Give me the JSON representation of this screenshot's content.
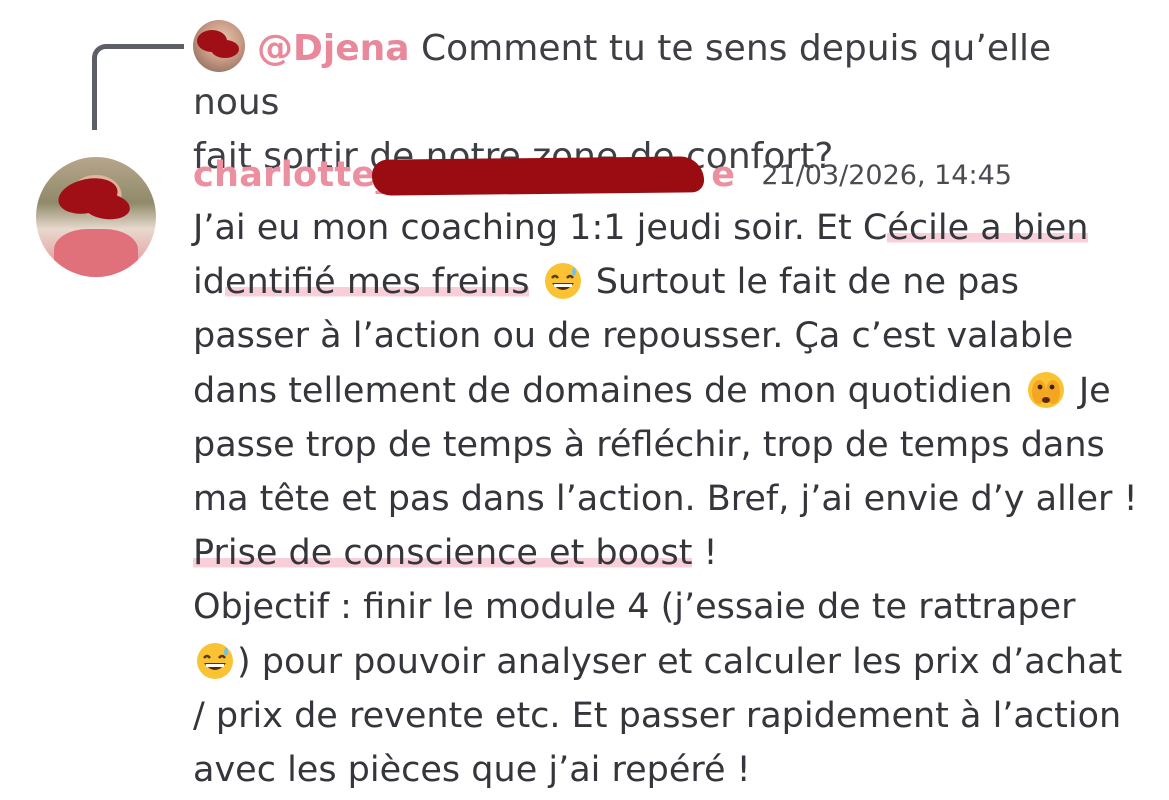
{
  "reply": {
    "mention": "@Djena",
    "text_line1": "Comment tu te sens depuis qu’elle nous",
    "text_line2": "fait sortir de notre zone de confort?"
  },
  "message": {
    "username": "charlotte_",
    "username_tail": "e",
    "timestamp": "21/03/2026, 14:45",
    "lines": {
      "l1a": "J’ai eu mon coaching 1:1 jeudi soir. Et C",
      "l1b": "écile a bien",
      "l2a": "id",
      "l2b": "entifié mes freins",
      "l2c": " Surtout le fait de ne pas",
      "l3": "passer à l’action ou de repousser. Ça c’est valable",
      "l4a": "dans tellement de domaines de mon quotidien",
      "l4b": " Je",
      "l5": "passe trop de temps à réfléchir, trop de temps dans",
      "l6": "ma tête et pas dans l’action. Bref, j’ai envie d’y aller !",
      "l7a": "Prise de conscience et boost",
      "l7b": " !",
      "l8": "Objectif : finir le module 4 (j’essaie de te rattraper",
      "l9": ") pour pouvoir analyser et calculer les prix d’achat",
      "l10": "/ prix de revente etc. Et passer rapidement à l’action",
      "l11": "avec les pièces que j’ai repéré !"
    }
  },
  "colors": {
    "username": "#ec8fa0",
    "mention": "#e8889a",
    "highlight": "#f8cfd9",
    "redaction": "#9b0c12"
  },
  "icons": {
    "emoji_1": "grinning-sweat-emoji",
    "emoji_2": "face-with-peeking-eye-emoji",
    "emoji_3": "grinning-sweat-emoji"
  }
}
